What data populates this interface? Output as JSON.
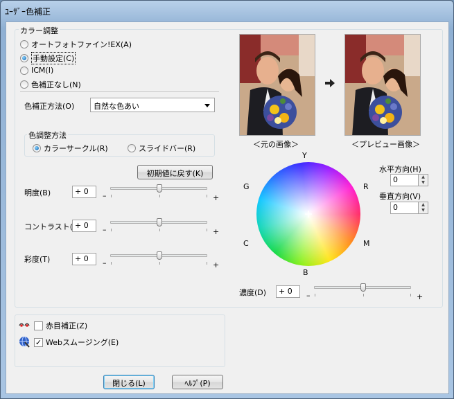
{
  "window": {
    "title": "ﾕｰｻﾞｰ色補正"
  },
  "color_adjust": {
    "title": "カラー調整",
    "options": [
      {
        "label": "オートフォトファイン!EX(A)",
        "selected": false
      },
      {
        "label": "手動設定(C)",
        "selected": true
      },
      {
        "label": "ICM(I)",
        "selected": false
      },
      {
        "label": "色補正なし(N)",
        "selected": false
      }
    ]
  },
  "method": {
    "label": "色補正方法(O)",
    "value": "自然な色あい"
  },
  "color_method": {
    "title": "色調整方法",
    "option1": "カラーサークル(R)",
    "option2": "スライドバー(R)"
  },
  "reset_button": "初期値に戻す(K)",
  "sliders": {
    "brightness": {
      "label": "明度(B)",
      "value": "+ 0",
      "level": 0
    },
    "contrast": {
      "label": "コントラスト(S)",
      "value": "+ 0",
      "level": 0
    },
    "saturation": {
      "label": "彩度(T)",
      "value": "+ 0",
      "level": 0
    },
    "density": {
      "label": "濃度(D)",
      "value": "+ 0",
      "level": 0
    },
    "minus": "–",
    "plus": "+"
  },
  "preview": {
    "original_caption": "＜元の画像＞",
    "preview_caption": "＜プレビュー画像＞"
  },
  "wheel": {
    "Y": "Y",
    "R": "R",
    "M": "M",
    "B": "B",
    "C": "C",
    "G": "G"
  },
  "offsets": {
    "horizontal_label": "水平方向(H)",
    "horizontal_value": "0",
    "vertical_label": "垂直方向(V)",
    "vertical_value": "0"
  },
  "extra": {
    "redeye_label": "赤目補正(Z)",
    "redeye_checked": false,
    "smoothing_label": "Webスムージング(E)",
    "smoothing_checked": true,
    "check_mark": "✓"
  },
  "footer": {
    "close_label": "閉じる(L)",
    "help_label": "ﾍﾙﾌﾟ(P)"
  }
}
